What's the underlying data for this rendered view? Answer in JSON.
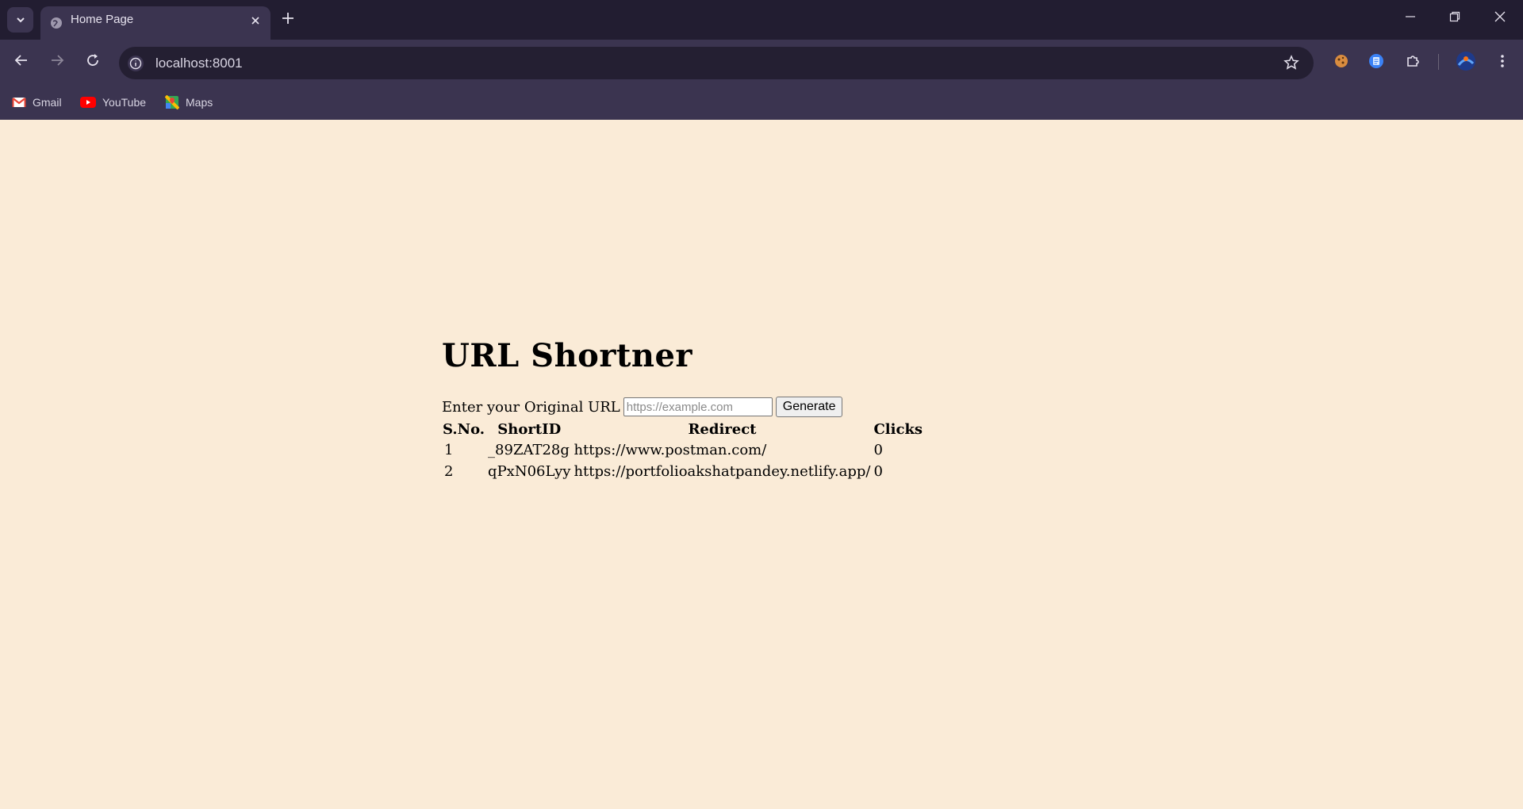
{
  "browser": {
    "tab_title": "Home Page",
    "url": "localhost:8001",
    "bookmarks": [
      {
        "label": "Gmail",
        "icon": "gmail-icon"
      },
      {
        "label": "YouTube",
        "icon": "youtube-icon"
      },
      {
        "label": "Maps",
        "icon": "maps-icon"
      }
    ]
  },
  "page": {
    "heading": "URL Shortner",
    "form": {
      "label": "Enter your Original URL",
      "input_placeholder": "https://example.com",
      "button_label": "Generate"
    },
    "table": {
      "headers": [
        "S.No.",
        "ShortID",
        "Redirect",
        "Clicks"
      ],
      "rows": [
        {
          "sno": "1",
          "short_id": "_89ZAT28g",
          "redirect": "https://www.postman.com/",
          "clicks": "0"
        },
        {
          "sno": "2",
          "short_id": "qPxN06Lyy",
          "redirect": "https://portfolioakshatpandey.netlify.app/",
          "clicks": "0"
        }
      ]
    }
  },
  "colors": {
    "page_background": "#faebd7",
    "chrome_dark": "#221d31",
    "chrome_mid": "#3b3450"
  }
}
